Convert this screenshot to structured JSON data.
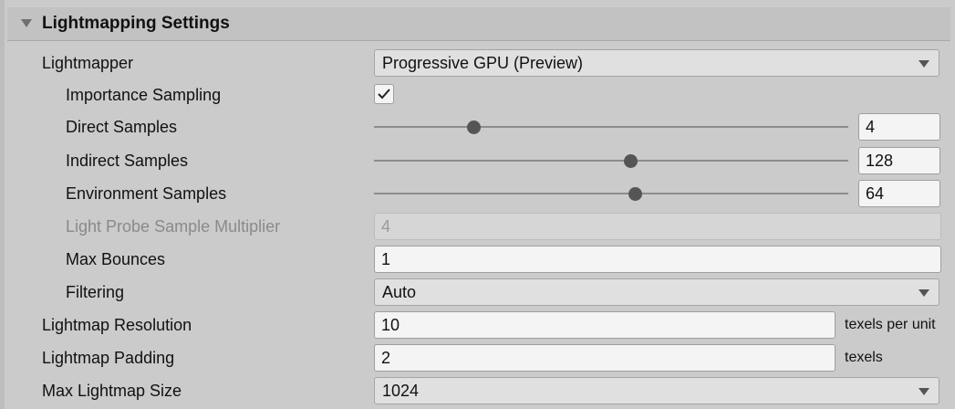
{
  "section": {
    "title": "Lightmapping Settings"
  },
  "lightmapper": {
    "label": "Lightmapper",
    "value": "Progressive GPU (Preview)"
  },
  "importance_sampling": {
    "label": "Importance Sampling",
    "checked": true
  },
  "direct_samples": {
    "label": "Direct Samples",
    "value": "4",
    "slider_fraction": 0.21
  },
  "indirect_samples": {
    "label": "Indirect Samples",
    "value": "128",
    "slider_fraction": 0.54
  },
  "environment_samples": {
    "label": "Environment Samples",
    "value": "64",
    "slider_fraction": 0.55
  },
  "light_probe_multiplier": {
    "label": "Light Probe Sample Multiplier",
    "value": "4"
  },
  "max_bounces": {
    "label": "Max Bounces",
    "value": "1"
  },
  "filtering": {
    "label": "Filtering",
    "value": "Auto"
  },
  "lightmap_resolution": {
    "label": "Lightmap Resolution",
    "value": "10",
    "unit": "texels per unit"
  },
  "lightmap_padding": {
    "label": "Lightmap Padding",
    "value": "2",
    "unit": "texels"
  },
  "max_lightmap_size": {
    "label": "Max Lightmap Size",
    "value": "1024"
  },
  "icons": {
    "foldout": "triangle-down-icon",
    "dropdown": "chevron-down-icon",
    "check": "checkmark-icon"
  }
}
